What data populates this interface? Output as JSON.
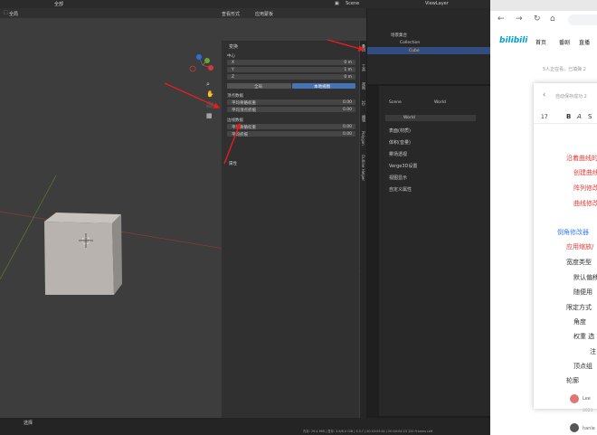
{
  "blender": {
    "topbar": {
      "view_menu": "全部",
      "scene_label": "Scene",
      "view_layer_label": "ViewLayer"
    },
    "viewport_header": {
      "snap_label": "全局",
      "overlay_label": "查看形式",
      "shading_label": "应用蒙板"
    },
    "npanel": {
      "section_title": "变换",
      "subtitle": "中心",
      "x_label": "X",
      "x_value": "0 m",
      "y_label": "Y",
      "y_value": "1 m",
      "z_label": "Z",
      "z_value": "0 m",
      "global_button": "全局",
      "local_button": "本地视图",
      "vertex_section": "顶点数据",
      "vertex_weight_label": "平均骨骼权重",
      "vertex_weight_value": "0.00",
      "vertex_crease_label": "平均顶点折痕",
      "vertex_crease_value": "0.00",
      "edge_section": "边线数据",
      "edge_weight_label": "平均骨骼权重",
      "edge_weight_value": "0.00",
      "edge_crease_label": "平均折痕",
      "edge_crease_value": "0.00",
      "properties_label": "属性",
      "tabs": [
        "条目",
        "工具",
        "视图",
        "3D",
        "编辑",
        "Polygon",
        "Outline Helper"
      ]
    },
    "outliner": {
      "root": "场景集合",
      "collection": "Collection",
      "cube": "Cube"
    },
    "properties": {
      "breadcrumb_scene": "Scene",
      "breadcrumb_world": "World",
      "world_field": "World",
      "sections": [
        "表面(材质)",
        "体积(音量)",
        "雾场透视",
        "Verge3D设置",
        "视图显示",
        "自定义属性"
      ]
    },
    "status": {
      "left_menu": "选择",
      "right_text": "内存: 29.4 MiB | 显存: 3.6/8.0 GiB | 3.3.7 | 00:03:09:01 / 00:00:04:23 120 Frames Left"
    }
  },
  "browser": {
    "logo": "bilibili",
    "nav": [
      "首页",
      "番剧",
      "直播"
    ],
    "online_text": "5人正在看，已填弹 2",
    "autosave_text": "自动保存成功 2",
    "font_size": "17",
    "doc_lines": [
      {
        "text": "沿着曲线的",
        "color": "#e53935"
      },
      {
        "text": "创建曲线",
        "color": "#e53935"
      },
      {
        "text": "阵列修改",
        "color": "#e53935"
      },
      {
        "text": "曲线修改",
        "color": "#e53935"
      },
      {
        "text": "倒角修改器",
        "color": "#3b82f6"
      },
      {
        "text": "应用缩放/",
        "color": "#e53935"
      },
      {
        "text": "宽度类型",
        "color": "#333333"
      },
      {
        "text": "默认偏移",
        "color": "#333333"
      },
      {
        "text": "随便用",
        "color": "#333333"
      },
      {
        "text": "限定方式",
        "color": "#333333"
      },
      {
        "text": "角度",
        "color": "#333333"
      },
      {
        "text": "权重 选",
        "color": "#333333"
      },
      {
        "text": "注",
        "color": "#333333"
      },
      {
        "text": "顶点组",
        "color": "#333333"
      },
      {
        "text": "轮廓",
        "color": "#333333"
      }
    ],
    "comment_user": "Lee",
    "comment_date": "2021",
    "comment_user2": "hanle"
  },
  "colors": {
    "blender_accent": "#4772b3",
    "bili_blue": "#00a1d6",
    "arrow_red": "#e02020"
  }
}
